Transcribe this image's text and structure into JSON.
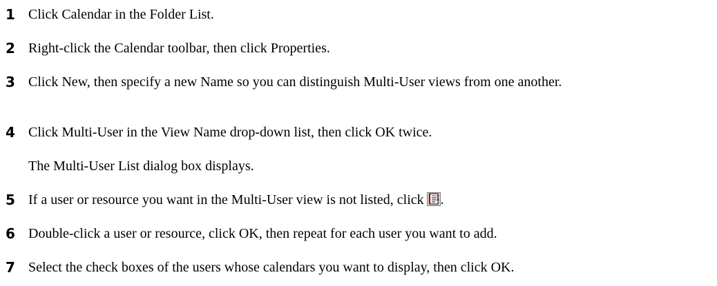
{
  "steps": [
    {
      "number": "1",
      "text": "Click Calendar in the Folder List."
    },
    {
      "number": "2",
      "text": "Right-click the Calendar toolbar, then click Properties."
    },
    {
      "number": "3",
      "text": "Click New, then specify a new Name so you can distinguish Multi-User views from one another."
    },
    {
      "number": "4",
      "text": "Click Multi-User in the View Name drop-down list, then click OK twice."
    },
    {
      "note": "The Multi-User List dialog box displays."
    },
    {
      "number": "5",
      "text": "If a user or resource you want in the Multi-User view is not listed, click",
      "trailing": ".",
      "icon": "address-book-icon"
    },
    {
      "number": "6",
      "text": "Double-click a user or resource, click OK, then repeat for each user you want to add."
    },
    {
      "number": "7",
      "text": "Select the check boxes of the users whose calendars you want to display, then click OK."
    }
  ]
}
